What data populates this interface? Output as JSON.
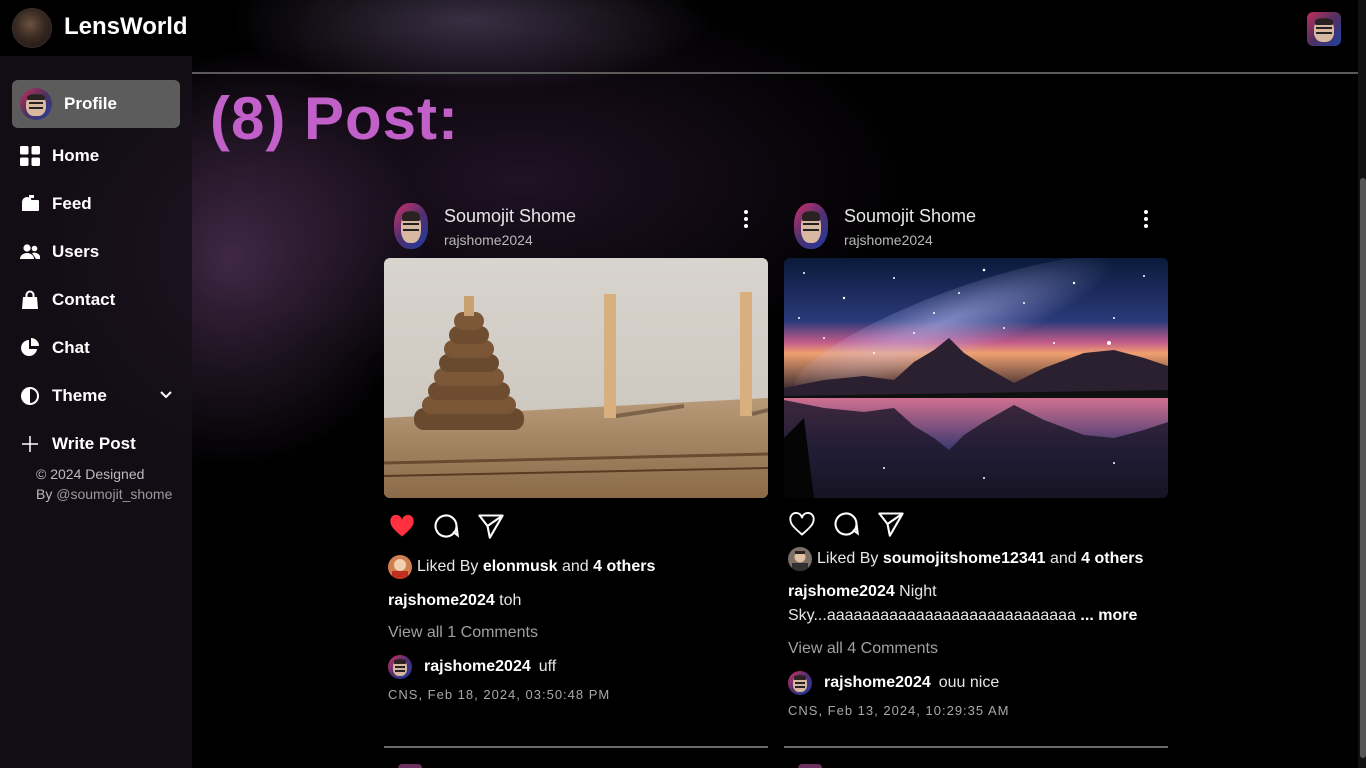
{
  "app": {
    "brand": "LensWorld"
  },
  "sidebar": {
    "items": [
      {
        "label": "Profile",
        "icon": "avatar"
      },
      {
        "label": "Home",
        "icon": "grid-icon"
      },
      {
        "label": "Feed",
        "icon": "mailbox-icon"
      },
      {
        "label": "Users",
        "icon": "users-icon"
      },
      {
        "label": "Contact",
        "icon": "bag-icon"
      },
      {
        "label": "Chat",
        "icon": "pie-chart-icon"
      },
      {
        "label": "Theme",
        "icon": "half-circle-icon"
      },
      {
        "label": "Write Post",
        "icon": "plus-icon"
      }
    ],
    "footer_line1": "© 2024 Designed",
    "footer_by": "By ",
    "footer_handle": "@soumojit_shome"
  },
  "main": {
    "heading": "(8) Post:"
  },
  "posts": [
    {
      "name": "Soumojit Shome",
      "handle": "rajshome2024",
      "liked_prefix": "Liked By ",
      "liked_user": "elonmusk",
      "liked_and": " and ",
      "liked_others": "4 others",
      "caption_user": "rajshome2024",
      "caption_text": " toh",
      "view_comments": "View all 1 Comments",
      "comment_user": "rajshome2024",
      "comment_text": "uff",
      "date": "CNS, Feb 18, 2024, 03:50:48 PM",
      "liked": true
    },
    {
      "name": "Soumojit Shome",
      "handle": "rajshome2024",
      "liked_prefix": "Liked By ",
      "liked_user": "soumojitshome12341",
      "liked_and": " and ",
      "liked_others": "4 others",
      "caption_user": "rajshome2024",
      "caption_text": " Night Sky...aaaaaaaaaaaaaaaaaaaaaaaaaaaa",
      "caption_more": " ... more",
      "view_comments": "View all 4 Comments",
      "comment_user": "rajshome2024",
      "comment_text": "ouu nice",
      "date": "CNS, Feb 13, 2024, 10:29:35 AM",
      "liked": false
    }
  ],
  "colors": {
    "accent": "#c060c8",
    "like_red": "#ff3040",
    "active_nav": "#5c5c5c"
  }
}
